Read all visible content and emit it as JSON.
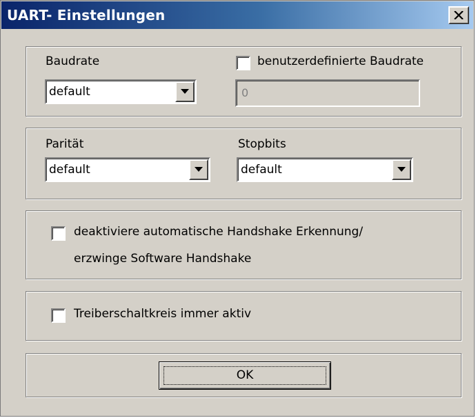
{
  "window": {
    "title": "UART- Einstellungen",
    "close_label": "close"
  },
  "baud": {
    "label": "Baudrate",
    "selected": "default",
    "custom_checkbox_label": "benutzerdefinierte Baudrate",
    "custom_checked": false,
    "custom_value": "0"
  },
  "parity": {
    "label": "Parität",
    "selected": "default"
  },
  "stopbits": {
    "label": "Stopbits",
    "selected": "default"
  },
  "handshake": {
    "label_line1": "deaktiviere automatische Handshake Erkennung/",
    "label_line2": "erzwinge Software Handshake",
    "checked": false
  },
  "driver": {
    "label": "Treiberschaltkreis immer aktiv",
    "checked": false
  },
  "buttons": {
    "ok_label": "OK"
  },
  "colors": {
    "title_gradient_start": "#0a246a",
    "title_gradient_end": "#a6caf0",
    "dialog_face": "#d4d0c8"
  }
}
